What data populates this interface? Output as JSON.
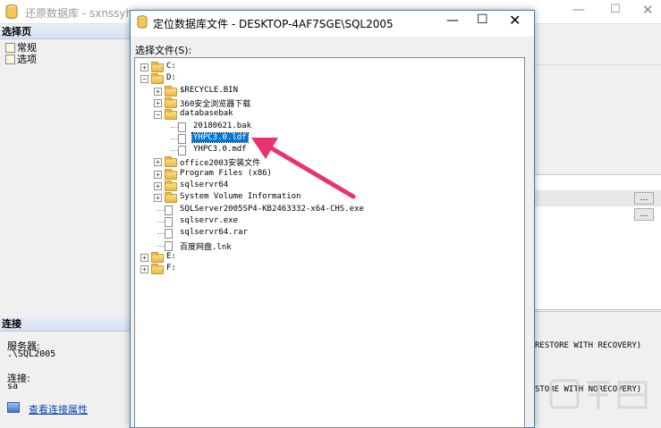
{
  "background_window": {
    "title": "还原数据库 - sxnssyhpc",
    "left_pane": {
      "select_page_header": "选择页",
      "pages": [
        "常规",
        "选项"
      ],
      "connection_header": "连接",
      "server_label": "服务器:",
      "server_value": ".\\SQL2005",
      "connection_label": "连接:",
      "connection_value": "sa",
      "view_connection_link": "查看连接属性"
    },
    "right_pane": {
      "restore_recovery": "RESTORE WITH RECOVERY)",
      "restore_norecovery": "STORE WITH NORECOVERY)",
      "ellipsis_label": "..."
    }
  },
  "dialog": {
    "title": "定位数据库文件 - DESKTOP-4AF7SGE\\SQL2005",
    "select_file_label": "选择文件(S):",
    "tree": [
      {
        "label": "C:",
        "type": "folder",
        "expander": "+"
      },
      {
        "label": "D:",
        "type": "folder",
        "expander": "-"
      },
      {
        "label": "$RECYCLE.BIN",
        "type": "folder",
        "expander": "+"
      },
      {
        "label": "360安全浏览器下载",
        "type": "folder",
        "expander": "+"
      },
      {
        "label": "databasebak",
        "type": "folder",
        "expander": "-"
      },
      {
        "label": "20180621.bak",
        "type": "file"
      },
      {
        "label": "YHPC3.0.ldf",
        "type": "file",
        "selected": true
      },
      {
        "label": "YHPC3.0.mdf",
        "type": "file"
      },
      {
        "label": "office2003安装文件",
        "type": "folder",
        "expander": "+"
      },
      {
        "label": "Program Files (x86)",
        "type": "folder",
        "expander": "+"
      },
      {
        "label": "sqlservr64",
        "type": "folder",
        "expander": "+"
      },
      {
        "label": "System Volume Information",
        "type": "folder",
        "expander": "+"
      },
      {
        "label": "SQLServer2005SP4-KB2463332-x64-CHS.exe",
        "type": "file"
      },
      {
        "label": "sqlservr.exe",
        "type": "file"
      },
      {
        "label": "sqlservr64.rar",
        "type": "file"
      },
      {
        "label": "百度网盘.lnk",
        "type": "file"
      },
      {
        "label": "E:",
        "type": "folder",
        "expander": "+"
      },
      {
        "label": "F:",
        "type": "folder",
        "expander": "+"
      }
    ]
  },
  "colors": {
    "selection": "#0078d7",
    "arrow": "#e8336b",
    "link": "#0645ad"
  }
}
